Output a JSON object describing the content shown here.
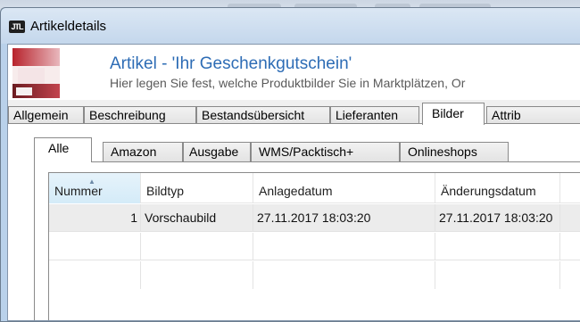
{
  "window": {
    "title": "Artikeldetails",
    "icon_text": "JTL"
  },
  "header": {
    "title": "Artikel - 'Ihr Geschenkgutschein'",
    "subtitle": "Hier legen Sie fest, welche Produktbilder Sie in Marktplätzen, Or"
  },
  "main_tabs": [
    {
      "label": "Allgemein"
    },
    {
      "label": "Beschreibung"
    },
    {
      "label": "Bestandsübersicht"
    },
    {
      "label": "Lieferanten"
    },
    {
      "label": "Bilder",
      "active": true
    },
    {
      "label": "Attrib"
    }
  ],
  "sub_tabs": [
    {
      "label": "Alle",
      "active": true
    },
    {
      "label": "Amazon"
    },
    {
      "label": "Ausgabe"
    },
    {
      "label": "WMS/Packtisch+"
    },
    {
      "label": "Onlineshops"
    }
  ],
  "grid": {
    "columns": [
      "Nummer",
      "Bildtyp",
      "Anlagedatum",
      "Änderungsdatum"
    ],
    "sorted_column": "Nummer",
    "rows": [
      [
        "1",
        "Vorschaubild",
        "27.11.2017 18:03:20",
        "27.11.2017 18:03:20"
      ]
    ]
  }
}
